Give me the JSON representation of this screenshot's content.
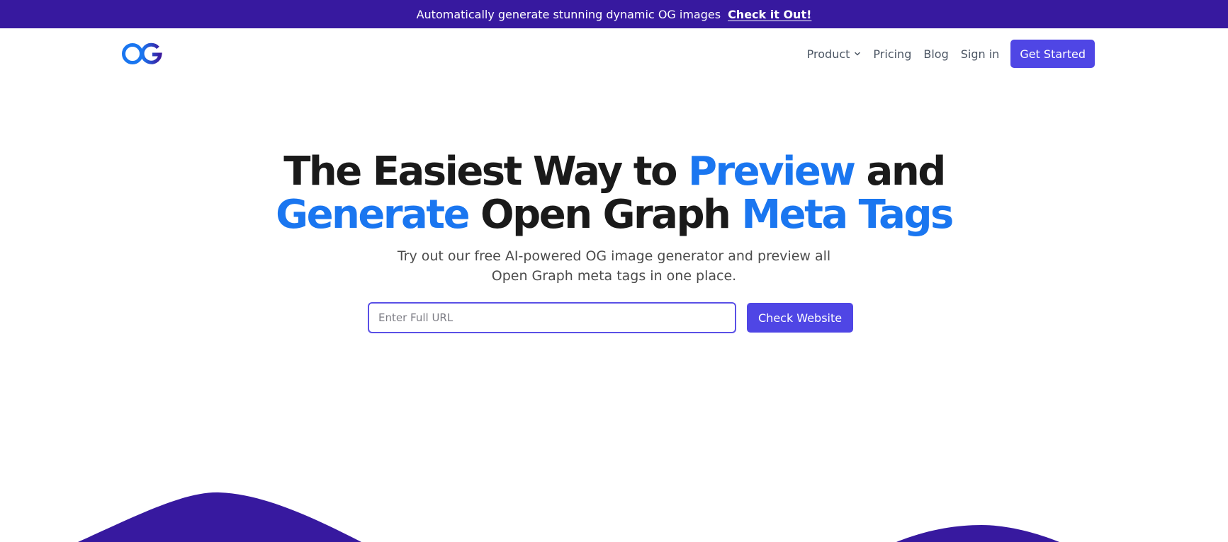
{
  "banner": {
    "message": "Automatically generate stunning dynamic OG images",
    "link": "Check it Out!"
  },
  "logo": {
    "text": "OG"
  },
  "nav": {
    "product": "Product",
    "pricing": "Pricing",
    "blog": "Blog",
    "sign_in": "Sign in",
    "get_started": "Get Started"
  },
  "hero": {
    "line1_a": "The Easiest Way to ",
    "line1_b": "Preview",
    "line1_c": " and",
    "line2_a": "Generate",
    "line2_b": " Open Graph ",
    "line2_c": "Meta Tags",
    "subtitle": "Try out our free AI-powered OG image generator and preview all Open Graph meta tags in one place."
  },
  "form": {
    "url_placeholder": "Enter Full URL",
    "url_value": "",
    "submit": "Check Website"
  },
  "colors": {
    "banner": "#37199f",
    "accent": "#4f46e5",
    "highlight": "#1a76f0",
    "wave": "#37199f"
  }
}
